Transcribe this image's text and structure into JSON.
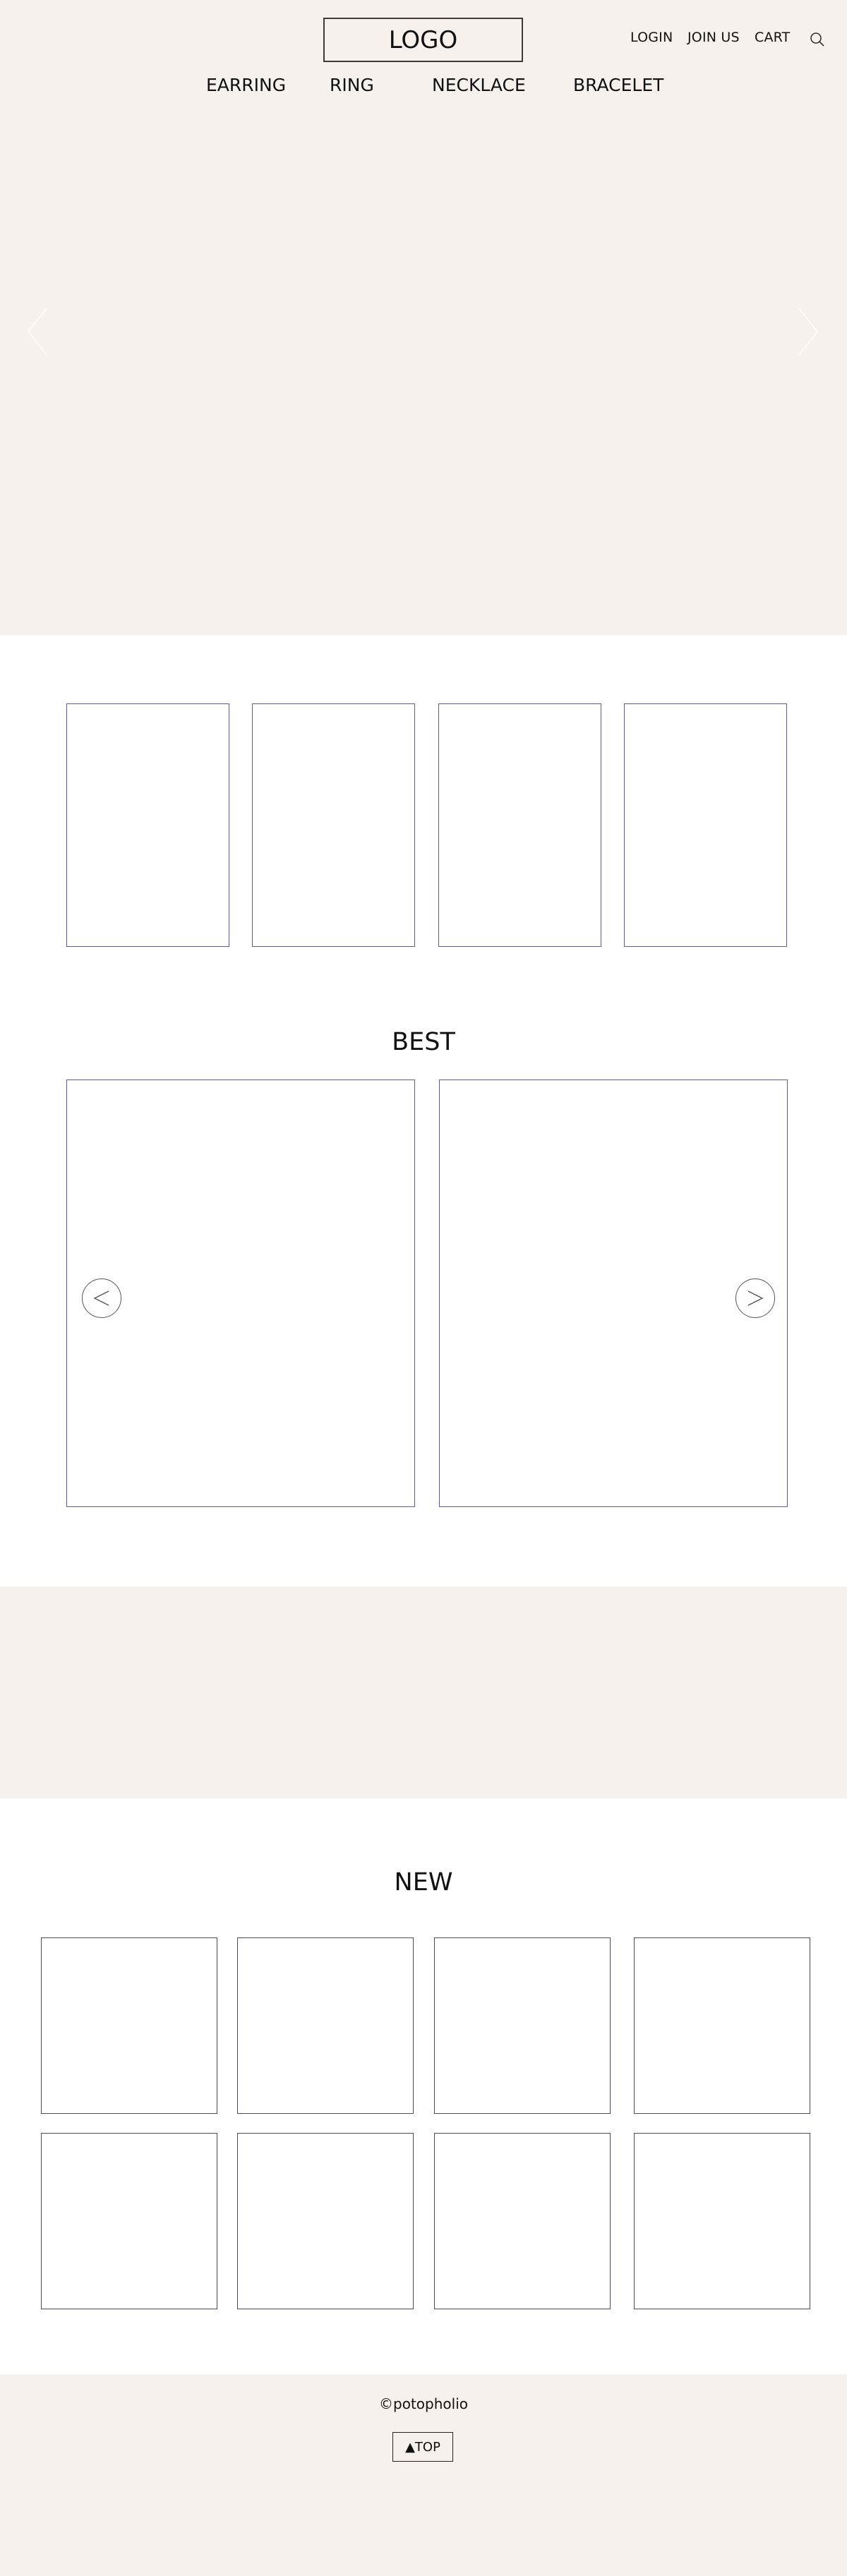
{
  "header": {
    "logo": "LOGO",
    "util_links": [
      "LOGIN",
      "JOIN US",
      "CART"
    ],
    "search_icon": "search-icon",
    "nav": [
      "EARRING",
      "RING",
      "NECKLACE",
      "BRACELET"
    ],
    "background": "#f6f1ec"
  },
  "hero": {
    "prev_icon": "chevron-left-icon",
    "next_icon": "chevron-right-icon"
  },
  "best": {
    "title": "BEST",
    "prev_icon": "chevron-left-icon",
    "next_icon": "chevron-right-icon",
    "border_color": "#5b5ba3"
  },
  "new_section": {
    "title": "NEW"
  },
  "footer": {
    "copyright": "©potopholio",
    "top_button": "▲TOP"
  }
}
